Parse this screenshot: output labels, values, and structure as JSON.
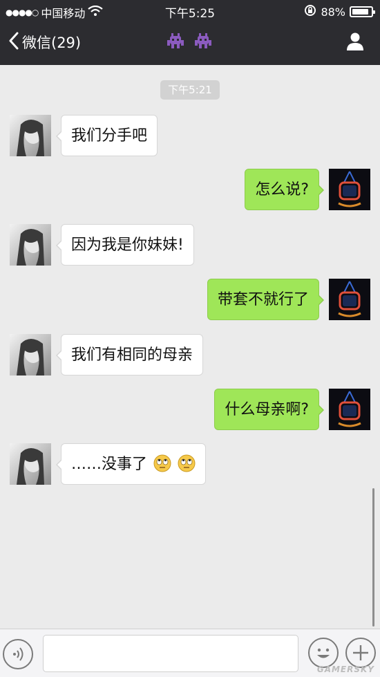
{
  "status_bar": {
    "signal_dots": "●●●●○",
    "carrier": "中国移动",
    "time": "下午5:25",
    "battery": "88%",
    "battery_level": 0.88
  },
  "nav": {
    "back_label": "微信(29)",
    "title_icons": [
      "alien-icon",
      "alien-icon"
    ],
    "right_icon": "person-icon"
  },
  "chat": {
    "timestamp": "下午5:21",
    "messages": [
      {
        "side": "in",
        "text": "我们分手吧"
      },
      {
        "side": "out",
        "text": "怎么说?"
      },
      {
        "side": "in",
        "text": "因为我是你妹妹!"
      },
      {
        "side": "out",
        "text": "带套不就行了"
      },
      {
        "side": "in",
        "text": "我们有相同的母亲"
      },
      {
        "side": "out",
        "text": "什么母亲啊?"
      },
      {
        "side": "in",
        "text": "……没事了",
        "emojis": [
          "rolling-eyes-emoji",
          "rolling-eyes-emoji"
        ]
      }
    ]
  },
  "input_bar": {
    "voice_icon": "voice-icon",
    "emoji_icon": "smiley-icon",
    "plus_icon": "plus-icon"
  },
  "watermark": "GAMERSKY",
  "colors": {
    "header_bg": "#2c2c30",
    "chat_bg": "#ebebeb",
    "outgoing_bubble": "#9fe658",
    "incoming_bubble": "#ffffff"
  }
}
